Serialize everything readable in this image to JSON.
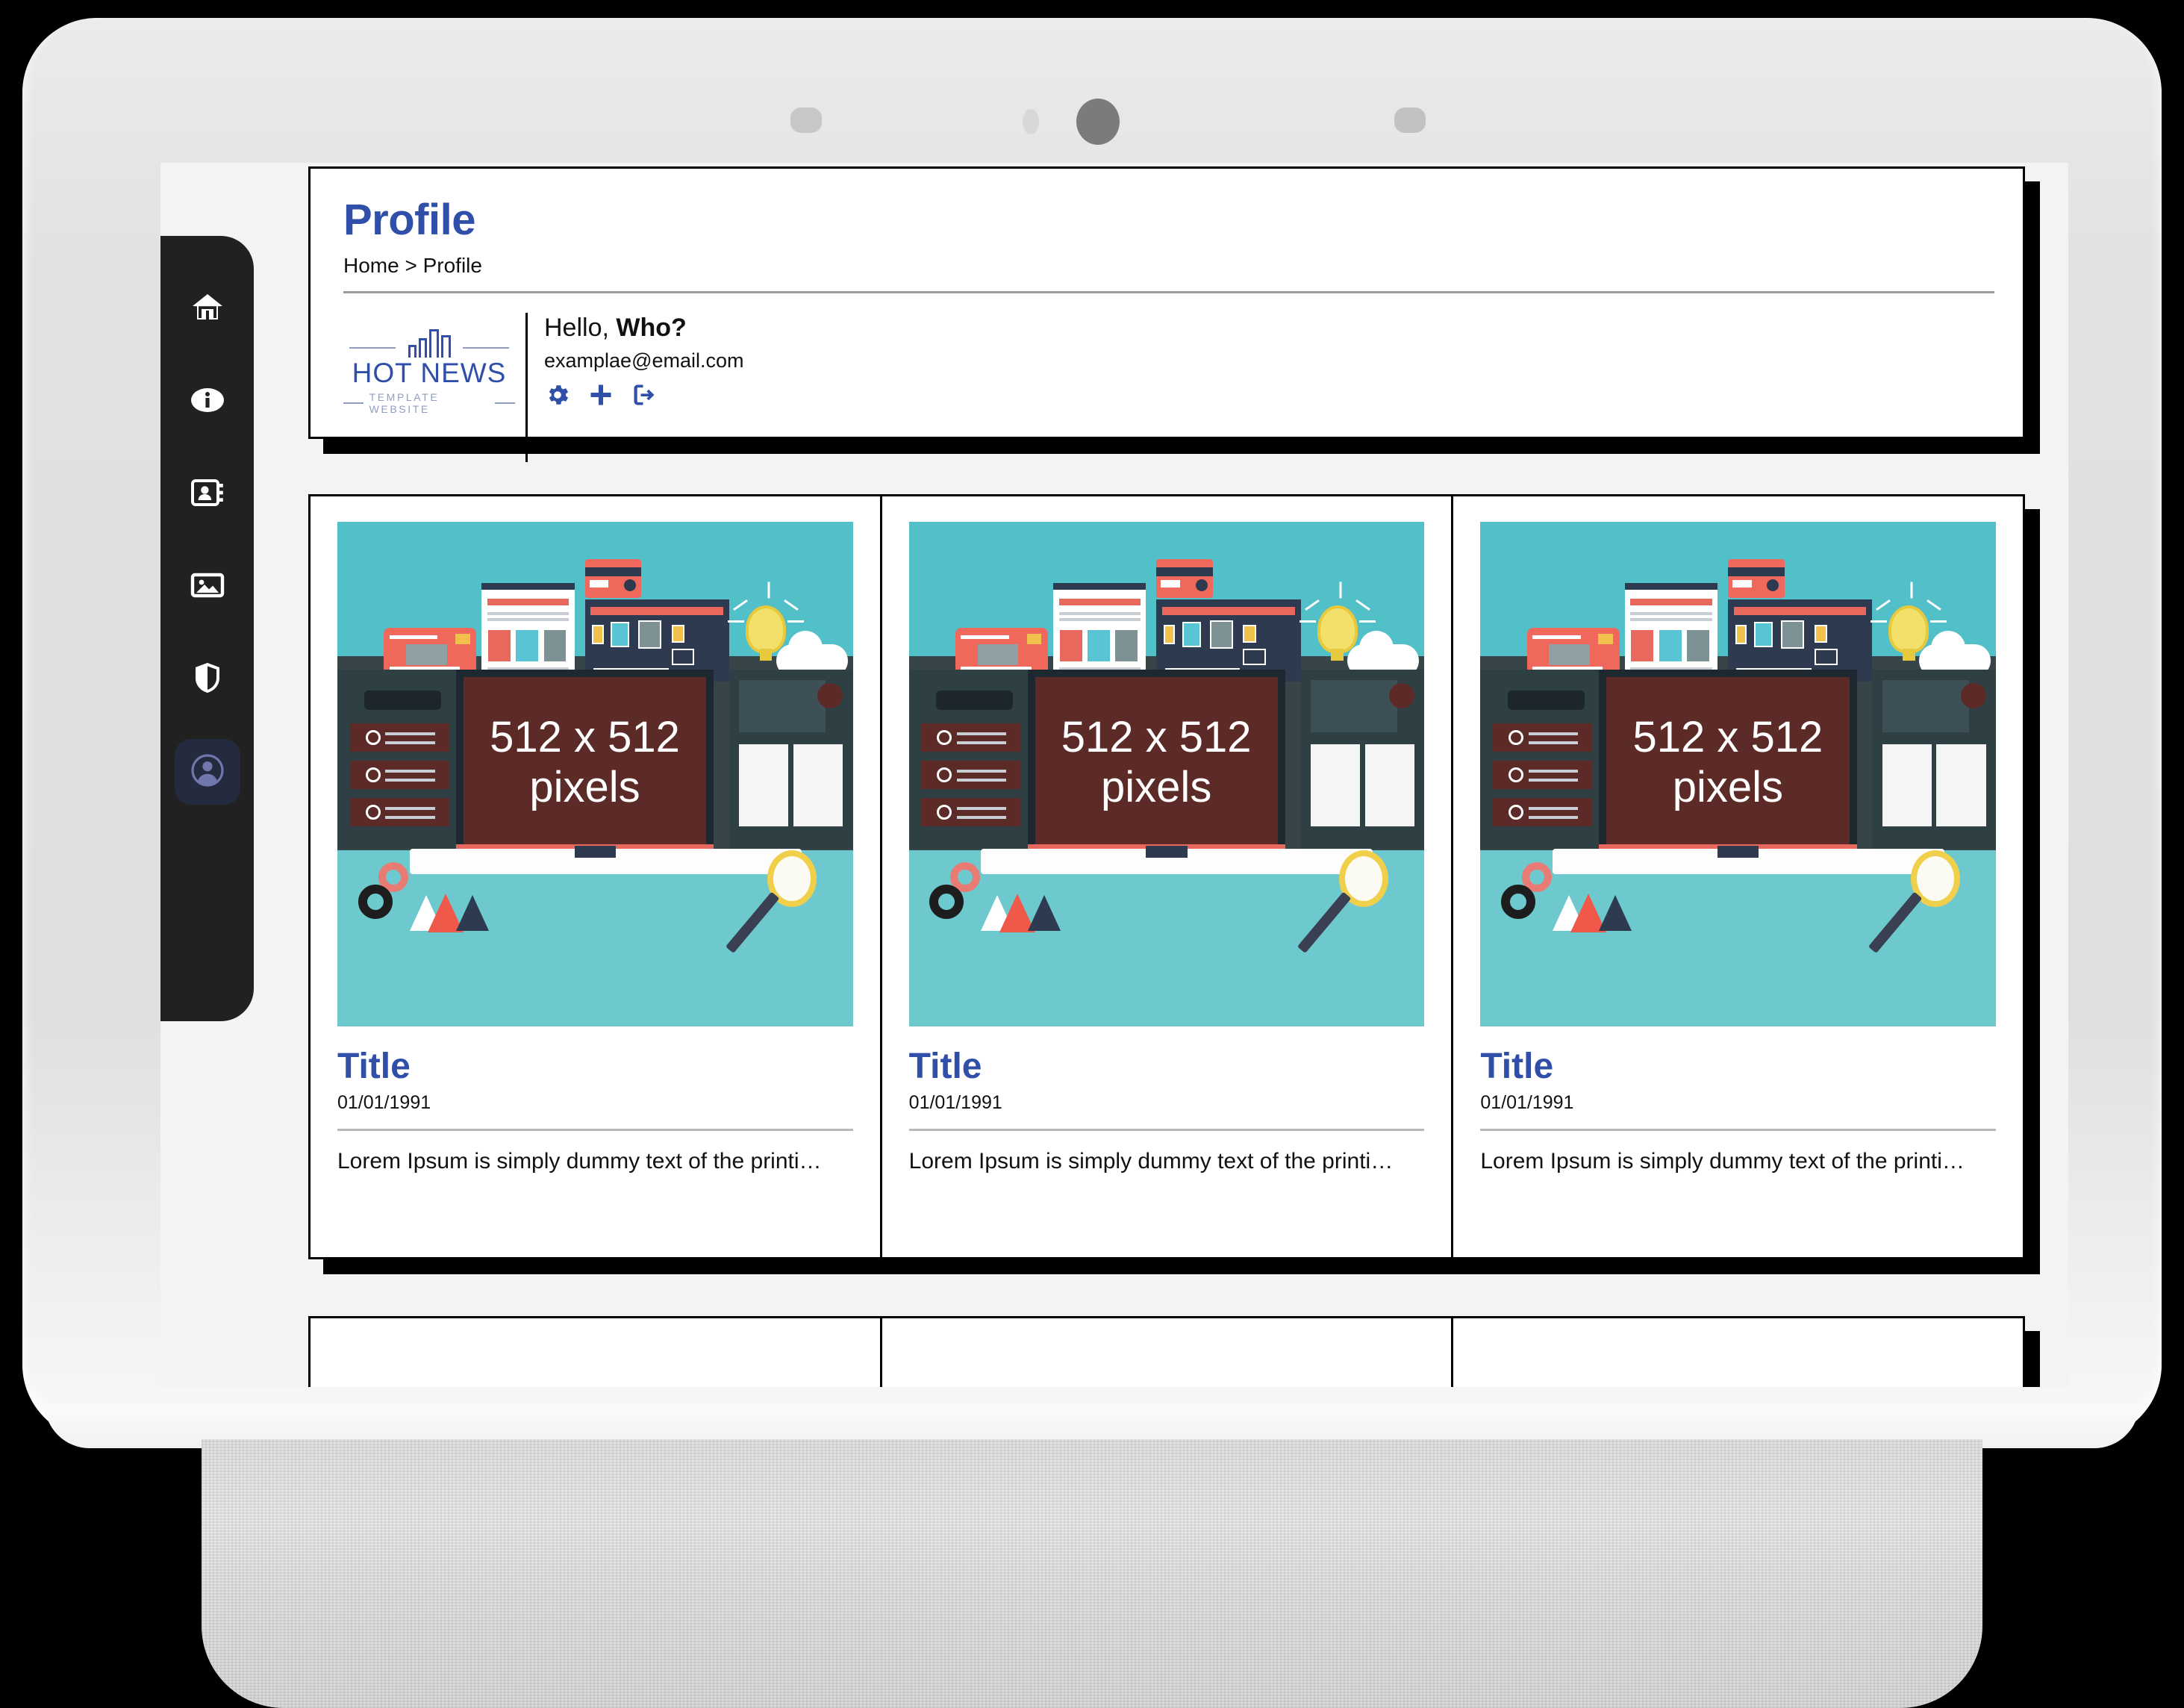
{
  "device": {
    "sensors": [
      "speaker-grille-left",
      "ambient-light-sensor",
      "camera-lens",
      "speaker-grille-right"
    ]
  },
  "sidebar": {
    "items": [
      {
        "name": "home",
        "icon": "home-icon",
        "label": "Home",
        "active": false
      },
      {
        "name": "info",
        "icon": "info-icon",
        "label": "Info",
        "active": false
      },
      {
        "name": "contacts",
        "icon": "contacts-icon",
        "label": "Contacts",
        "active": false
      },
      {
        "name": "gallery",
        "icon": "image-icon",
        "label": "Gallery",
        "active": false
      },
      {
        "name": "security",
        "icon": "shield-icon",
        "label": "Security",
        "active": false
      },
      {
        "name": "profile",
        "icon": "user-icon",
        "label": "Profile",
        "active": true
      }
    ]
  },
  "header": {
    "title": "Profile",
    "breadcrumb": "Home > Profile",
    "brand": {
      "word": "HOT NEWS",
      "tagline": "TEMPLATE WEBSITE"
    },
    "greeting_prefix": "Hello, ",
    "greeting_name": "Who?",
    "email": "examplae@email.com",
    "actions": [
      {
        "name": "settings",
        "icon": "gear-icon",
        "label": "Settings"
      },
      {
        "name": "add",
        "icon": "plus-icon",
        "label": "Add"
      },
      {
        "name": "logout",
        "icon": "sign-out-icon",
        "label": "Log out"
      }
    ]
  },
  "cards": [
    {
      "image_label_line1": "512 x 512",
      "image_label_line2": "pixels",
      "title": "Title",
      "date": "01/01/1991",
      "description": "Lorem Ipsum is simply dummy text of the printi…"
    },
    {
      "image_label_line1": "512 x 512",
      "image_label_line2": "pixels",
      "title": "Title",
      "date": "01/01/1991",
      "description": "Lorem Ipsum is simply dummy text of the printi…"
    },
    {
      "image_label_line1": "512 x 512",
      "image_label_line2": "pixels",
      "title": "Title",
      "date": "01/01/1991",
      "description": "Lorem Ipsum is simply dummy text of the printi…"
    }
  ],
  "colors": {
    "accent_blue": "#2f4fa8",
    "sidebar_bg": "#212121",
    "sidebar_active_bg": "#242b3f",
    "sidebar_active_icon": "#6f77ad",
    "app_bg": "#f3f3f3",
    "panel_border": "#000000",
    "illustration_sky": "#52c0c8",
    "illustration_screen": "#5c2b28"
  }
}
